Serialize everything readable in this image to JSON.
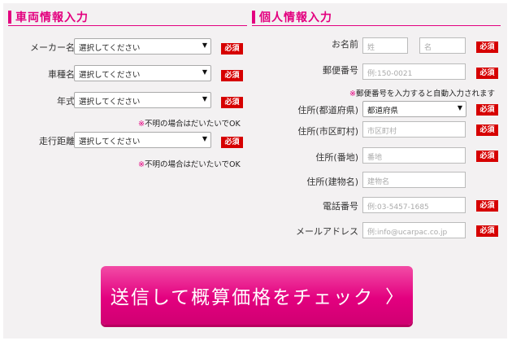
{
  "vehicle": {
    "title": "車両情報入力",
    "fields": [
      {
        "label": "メーカー名",
        "value": "選択してください",
        "required": "必須"
      },
      {
        "label": "車種名",
        "value": "選択してください",
        "required": "必須"
      },
      {
        "label": "年式",
        "value": "選択してください",
        "required": "必須"
      },
      {
        "label": "走行距離",
        "value": "選択してください",
        "required": "必須"
      }
    ],
    "note_mark": "※",
    "note_text": "不明の場合はだいたいでOK"
  },
  "personal": {
    "title": "個人情報入力",
    "name": {
      "label": "お名前",
      "last_placeholder": "姓",
      "first_placeholder": "名",
      "required": "必須"
    },
    "zip": {
      "label": "郵便番号",
      "placeholder": "例:150-0021",
      "required": "必須"
    },
    "zip_note_mark": "※",
    "zip_note_text": "郵便番号を入力すると自動入力されます",
    "prefecture": {
      "label": "住所(都道府県)",
      "value": "都道府県",
      "required": "必須"
    },
    "city": {
      "label": "住所(市区町村)",
      "placeholder": "市区町村",
      "required": "必須"
    },
    "street": {
      "label": "住所(番地)",
      "placeholder": "番地",
      "required": "必須"
    },
    "building": {
      "label": "住所(建物名)",
      "placeholder": "建物名"
    },
    "phone": {
      "label": "電話番号",
      "placeholder": "例:03-5457-1685",
      "required": "必須"
    },
    "email": {
      "label": "メールアドレス",
      "placeholder": "例:info@ucarpac.co.jp",
      "required": "必須"
    }
  },
  "submit": {
    "label": "送信して概算価格をチェック",
    "chevron": "〉"
  },
  "icons": {
    "dropdown": "▼"
  },
  "colors": {
    "accent": "#e3007f",
    "required_badge": "#d60000",
    "background": "#f3f1f2"
  }
}
